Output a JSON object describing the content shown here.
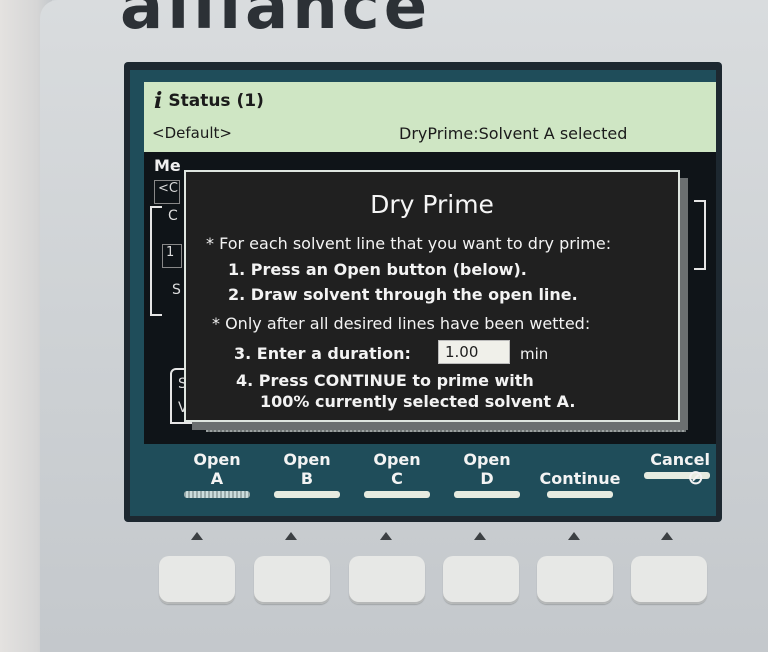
{
  "brand": "alliance",
  "status": {
    "icon": "info-icon",
    "title": "Status (1)",
    "profile": "<Default>",
    "message": "DryPrime:Solvent A selected"
  },
  "background": {
    "tab": "Me",
    "fragments": [
      "<C",
      "C",
      "1",
      "S",
      "Sy",
      "Vi"
    ]
  },
  "dialog": {
    "title": "Dry Prime",
    "bullet1": "* For each solvent line that you want to dry prime:",
    "step1": "1. Press an Open button (below).",
    "step2": "2. Draw solvent through the open line.",
    "bullet2": "* Only after all desired lines have been wetted:",
    "step3": "3. Enter a duration:",
    "duration_value": "1.00",
    "duration_unit": "min",
    "step4a": "4. Press CONTINUE to prime with",
    "step4b": "100% currently selected solvent A."
  },
  "softkeys": [
    {
      "line1": "Open",
      "line2": "A",
      "selected": true
    },
    {
      "line1": "Open",
      "line2": "B",
      "selected": false
    },
    {
      "line1": "Open",
      "line2": "C",
      "selected": false
    },
    {
      "line1": "Open",
      "line2": "D",
      "selected": false
    },
    {
      "line1": "",
      "line2": "Continue",
      "selected": false
    },
    {
      "line1": "Cancel",
      "line2": "",
      "icon": "cancel-icon",
      "selected": false
    }
  ],
  "colors": {
    "status_bar": "#cfe6c4",
    "dialog_bg": "#202020",
    "lcd_bg": "#1f4d5a",
    "key": "#e7e8e6"
  }
}
